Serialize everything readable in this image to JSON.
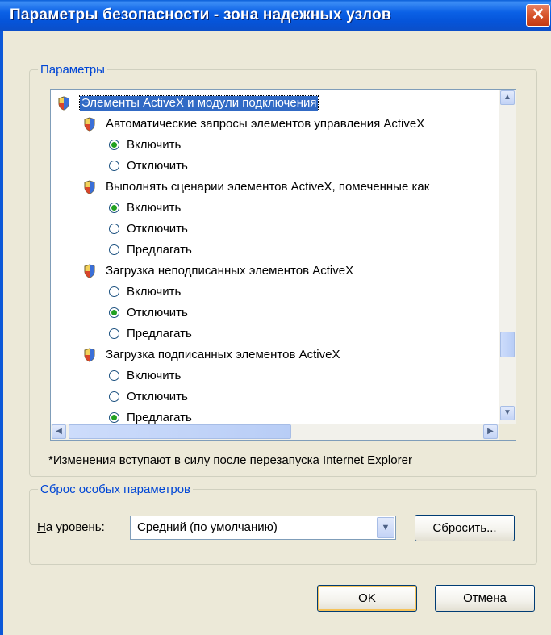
{
  "window": {
    "title": "Параметры безопасности - зона надежных узлов",
    "close_label": "✕"
  },
  "settings_group": {
    "legend": "Параметры"
  },
  "tree": {
    "category": {
      "label": "Элементы ActiveX и модули подключения",
      "icon": "shield-icon"
    },
    "items": [
      {
        "label": "Автоматические запросы элементов управления ActiveX",
        "options": [
          {
            "label": "Включить",
            "selected": true
          },
          {
            "label": "Отключить",
            "selected": false
          }
        ]
      },
      {
        "label": "Выполнять сценарии элементов ActiveX, помеченные как",
        "options": [
          {
            "label": "Включить",
            "selected": true
          },
          {
            "label": "Отключить",
            "selected": false
          },
          {
            "label": "Предлагать",
            "selected": false
          }
        ]
      },
      {
        "label": "Загрузка неподписанных элементов ActiveX",
        "options": [
          {
            "label": "Включить",
            "selected": false
          },
          {
            "label": "Отключить",
            "selected": true
          },
          {
            "label": "Предлагать",
            "selected": false
          }
        ]
      },
      {
        "label": "Загрузка подписанных элементов ActiveX",
        "options": [
          {
            "label": "Включить",
            "selected": false
          },
          {
            "label": "Отключить",
            "selected": false
          },
          {
            "label": "Предлагать",
            "selected": true
          }
        ]
      }
    ]
  },
  "note": "*Изменения вступают в силу после перезапуска Internet Explorer",
  "reset_group": {
    "legend": "Сброс особых параметров",
    "level_label_accel": "Н",
    "level_label_rest": "а уровень:",
    "level_value": "Средний (по умолчанию)",
    "reset_button_accel": "С",
    "reset_button_rest": "бросить..."
  },
  "buttons": {
    "ok": "OK",
    "cancel": "Отмена"
  }
}
